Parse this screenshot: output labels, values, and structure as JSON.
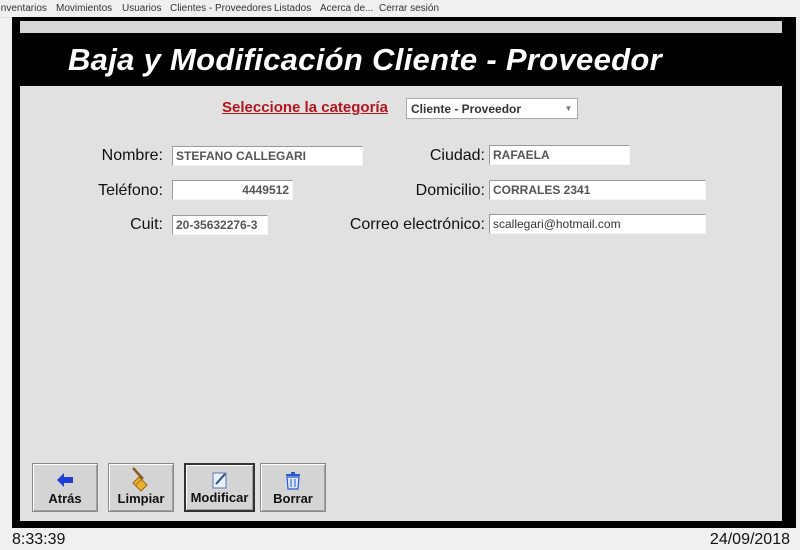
{
  "menu": [
    "Inventarios",
    "Movimientos",
    "Usuarios",
    "Clientes - Proveedores",
    "Listados",
    "Acerca de...",
    "Cerrar sesión"
  ],
  "title": "Baja y Modificación Cliente - Proveedor",
  "category": {
    "label": "Seleccione la categoría",
    "selected": "Cliente - Proveedor"
  },
  "form": {
    "nombre": {
      "label": "Nombre:",
      "value": "STEFANO CALLEGARI"
    },
    "telefono": {
      "label": "Teléfono:",
      "value": "4449512"
    },
    "cuit": {
      "label": "Cuit:",
      "value": "20-35632276-3"
    },
    "ciudad": {
      "label": "Ciudad:",
      "value": "RAFAELA"
    },
    "domicilio": {
      "label": "Domicilio:",
      "value": "CORRALES 2341"
    },
    "correo": {
      "label": "Correo electrónico:",
      "value": "scallegari@hotmail.com"
    }
  },
  "buttons": {
    "atras": "Atrás",
    "limpiar": "Limpiar",
    "modificar": "Modificar",
    "borrar": "Borrar"
  },
  "status": {
    "time": "8:33:39",
    "date": "24/09/2018"
  },
  "colors": {
    "title_bg": "#000000",
    "category_label": "#b2161f",
    "panel_bg": "#e1e1e1"
  }
}
